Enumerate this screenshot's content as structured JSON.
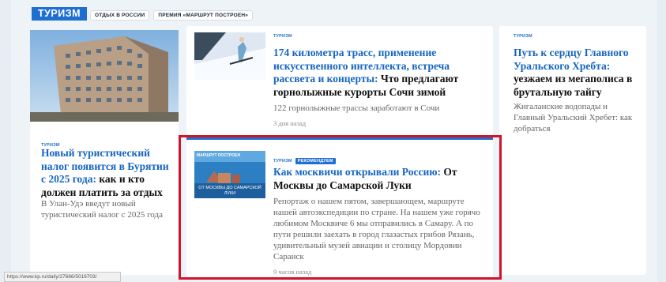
{
  "section": {
    "title": "ТУРИЗМ"
  },
  "subnav": [
    {
      "label": "ОТДЫХ В РОССИИ"
    },
    {
      "label": "ПРЕМИЯ «МАРШРУТ ПОСТРОЕН»"
    }
  ],
  "cards": {
    "left": {
      "tag": "ТУРИЗМ",
      "title_lead": "Новый туристический налог появится в Бурятии с 2025 года:",
      "title_rest": " как и кто должен платить за отдых",
      "desc": "В Улан-Удэ введут новый туристический налог с 2025 года"
    },
    "top_middle": {
      "tag": "ТУРИЗМ",
      "title_lead": "174 километра трасс, применение искусственного интеллекта, встреча рассвета и концерты:",
      "title_rest": " Что предлагают горнолыжные курорты Сочи зимой",
      "desc": "122 горнолыжные трассы заработают в Сочи",
      "time": "3 дня назад"
    },
    "right": {
      "tag": "ТУРИЗМ",
      "title_lead": "Путь к сердцу Главного Уральского Хребта:",
      "title_rest": " уезжаем из мегаполиса в брутальную тайгу",
      "desc": "Жигаланские водопады и Главный Уральский Хребет: как добраться"
    },
    "featured": {
      "tag": "ТУРИЗМ",
      "tag2": "РЕКОМЕНДУЕМ",
      "thumb_logo": "МАРШРУТ ПОСТРОЕН",
      "thumb_caption": "ОТ МОСКВЫ ДО САМАРСКОЙ ЛУКИ",
      "title_lead": "Как москвичи открывали Россию:",
      "title_rest": " От Москвы до Самарской Луки",
      "desc": "Репортаж о нашем пятом, завершающем, маршруте нашей автоэкспедиции по стране. На нашем уже горячо любимом Москвиче 6 мы отправились в Самару. А по пути решили заехать в город глазастых грибов Рязань, удивительный музей авиации и столицу Мордовии Саранск",
      "time": "9 часов назад"
    }
  },
  "status_url": "https://www.kp.ru/daily/27666/5016703/",
  "colors": {
    "accent": "#1f6fd1",
    "highlight": "#d0142a"
  }
}
